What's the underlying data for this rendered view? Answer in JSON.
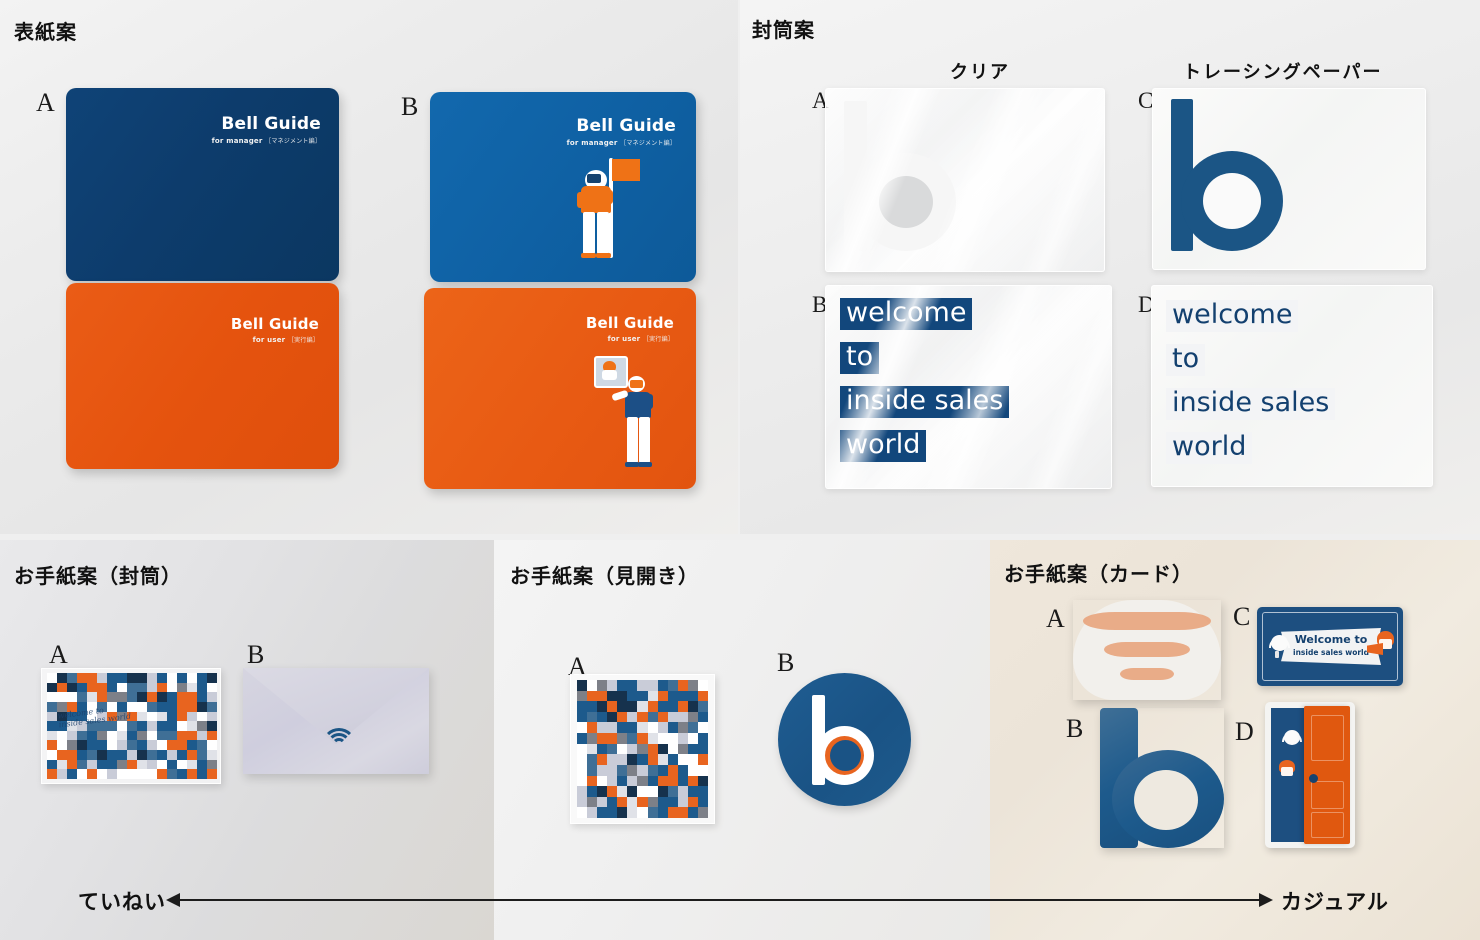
{
  "sections": {
    "cover": {
      "title": "表紙案",
      "items": [
        {
          "label": "A",
          "variant": "navy",
          "brand": "Bell Guide",
          "sub_en": "for manager",
          "sub_jp": "［マネジメント編］",
          "illustration": "none"
        },
        {
          "label": "B",
          "variant": "blue",
          "brand": "Bell Guide",
          "sub_en": "for manager",
          "sub_jp": "［マネジメント編］",
          "illustration": "person-with-flag"
        },
        {
          "label": "",
          "variant": "orange",
          "brand": "Bell Guide",
          "sub_en": "for user",
          "sub_jp": "［実行編］",
          "illustration": "none"
        },
        {
          "label": "",
          "variant": "orange2",
          "brand": "Bell Guide",
          "sub_en": "for user",
          "sub_jp": "［実行編］",
          "illustration": "person-with-screen"
        }
      ]
    },
    "envelope": {
      "title": "封筒案",
      "columns": [
        {
          "label": "クリア"
        },
        {
          "label": "トレーシングペーパー"
        }
      ],
      "items": [
        {
          "label": "A",
          "material": "clear",
          "motif": "b-letter-white"
        },
        {
          "label": "C",
          "material": "tracing",
          "motif": "b-letter-blue"
        },
        {
          "label": "B",
          "material": "clear",
          "motif": "welcome-text-inverse"
        },
        {
          "label": "D",
          "material": "tracing",
          "motif": "welcome-text"
        }
      ],
      "welcome_lines": [
        "welcome",
        "to",
        "inside sales",
        "world"
      ]
    },
    "letter_envelope": {
      "title": "お手紙案（封筒）",
      "items": [
        {
          "label": "A",
          "motif": "mosaic-card-in-clear-sleeve",
          "handwriting": [
            "welcome to",
            "inside sales world"
          ]
        },
        {
          "label": "B",
          "motif": "lavender-envelope-with-signal-mark"
        }
      ]
    },
    "letter_spread": {
      "title": "お手紙案（見開き）",
      "items": [
        {
          "label": "A",
          "motif": "mosaic-square-card"
        },
        {
          "label": "B",
          "motif": "round-b-logo-card"
        }
      ]
    },
    "letter_card": {
      "title": "お手紙案（カード）",
      "items": [
        {
          "label": "A",
          "motif": "signal-wifi-diecut-card"
        },
        {
          "label": "B",
          "motif": "b-letter-diecut-card"
        },
        {
          "label": "C",
          "motif": "banner-welcome-card",
          "banner_top": "Welcome to",
          "banner_bottom": "inside sales world"
        },
        {
          "label": "D",
          "motif": "open-door-card"
        }
      ]
    }
  },
  "axis": {
    "left_label": "ていねい",
    "right_label": "カジュアル"
  },
  "colors": {
    "navy": "#0d3c6c",
    "blue": "#1064a8",
    "orange": "#e85a15",
    "teal_blue": "#1d5a8c",
    "lavender": "#d3d2df",
    "card_bg": "#efe7db"
  }
}
